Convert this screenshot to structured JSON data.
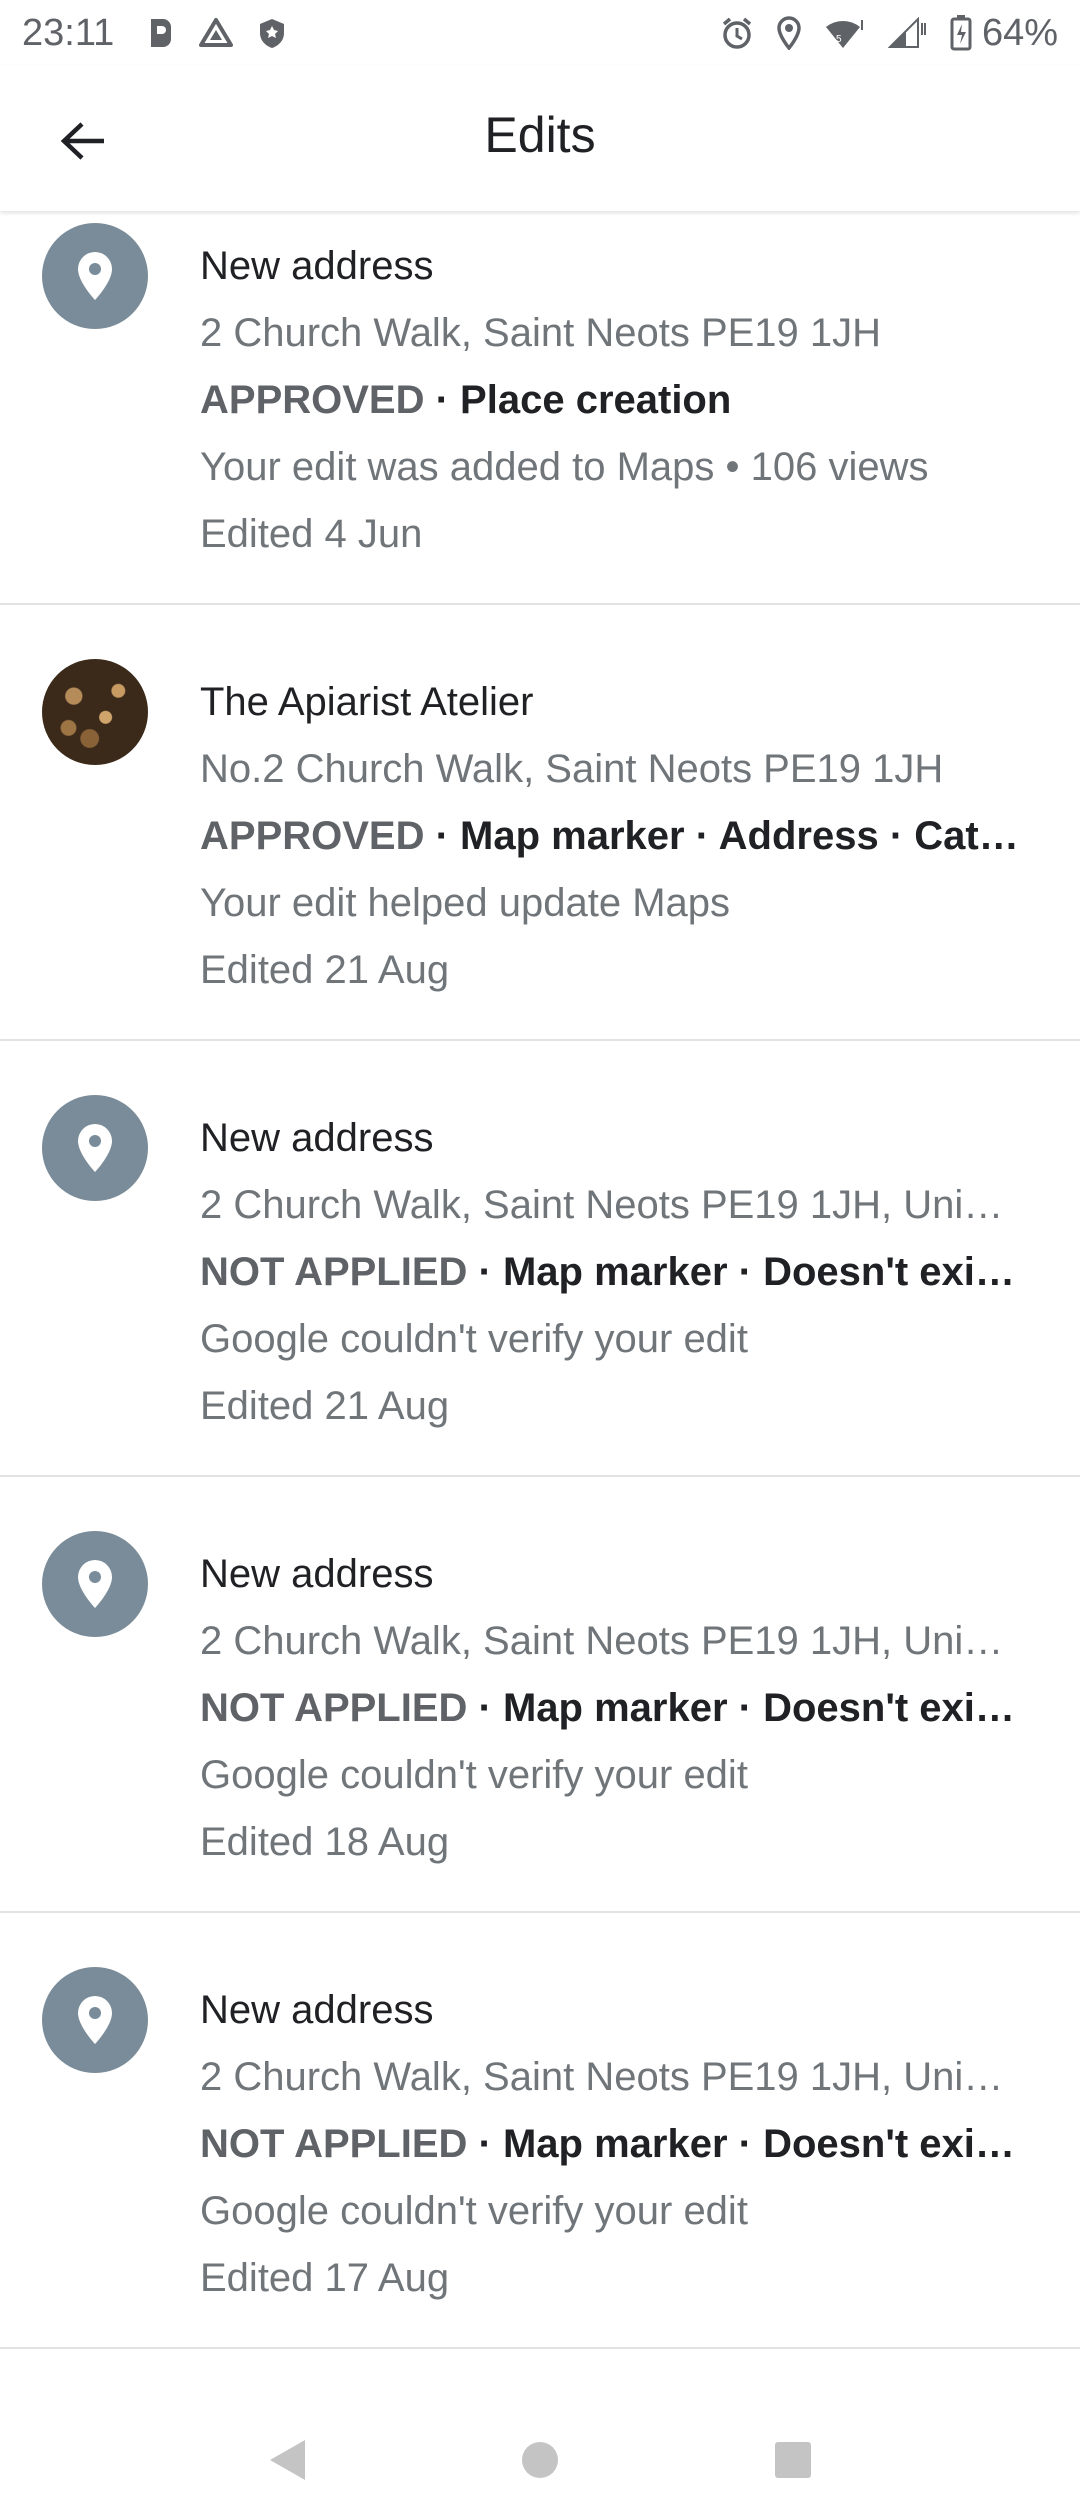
{
  "status_bar": {
    "time": "23:11",
    "battery": "64%",
    "icons_left": [
      "notification-icon",
      "drive-icon",
      "shield-icon"
    ],
    "icons_right": [
      "alarm-icon",
      "location-icon",
      "wifi-icon",
      "signal-icon",
      "battery-icon"
    ]
  },
  "app_bar": {
    "title": "Edits"
  },
  "edits": [
    {
      "title": "New address",
      "address": "2 Church Walk, Saint Neots PE19 1JH",
      "status": "APPROVED",
      "details": " · Place creation",
      "message": "Your edit was added to Maps • 106 views",
      "date": "Edited 4 Jun",
      "avatar": "place-pin-icon"
    },
    {
      "title": "The Apiarist Atelier",
      "address": "No.2 Church Walk, Saint Neots PE19 1JH",
      "status": "APPROVED",
      "details": " · Map marker · Address · Cat…",
      "message": "Your edit helped update Maps",
      "date": "Edited 21 Aug",
      "avatar": "business-photo"
    },
    {
      "title": "New address",
      "address": "2 Church Walk, Saint Neots PE19 1JH, Uni…",
      "status": "NOT APPLIED",
      "details": " · Map marker · Doesn't exi…",
      "message": "Google couldn't verify your edit",
      "date": "Edited 21 Aug",
      "avatar": "place-pin-icon"
    },
    {
      "title": "New address",
      "address": "2 Church Walk, Saint Neots PE19 1JH, Uni…",
      "status": "NOT APPLIED",
      "details": " · Map marker · Doesn't exi…",
      "message": "Google couldn't verify your edit",
      "date": "Edited 18 Aug",
      "avatar": "place-pin-icon"
    },
    {
      "title": "New address",
      "address": "2 Church Walk, Saint Neots PE19 1JH, Uni…",
      "status": "NOT APPLIED",
      "details": " · Map marker · Doesn't exi…",
      "message": "Google couldn't verify your edit",
      "date": "Edited 17 Aug",
      "avatar": "place-pin-icon"
    }
  ],
  "colors": {
    "avatar_bg": "#7a8c99",
    "divider": "#e3e3e3",
    "secondary_text": "#70757a"
  }
}
